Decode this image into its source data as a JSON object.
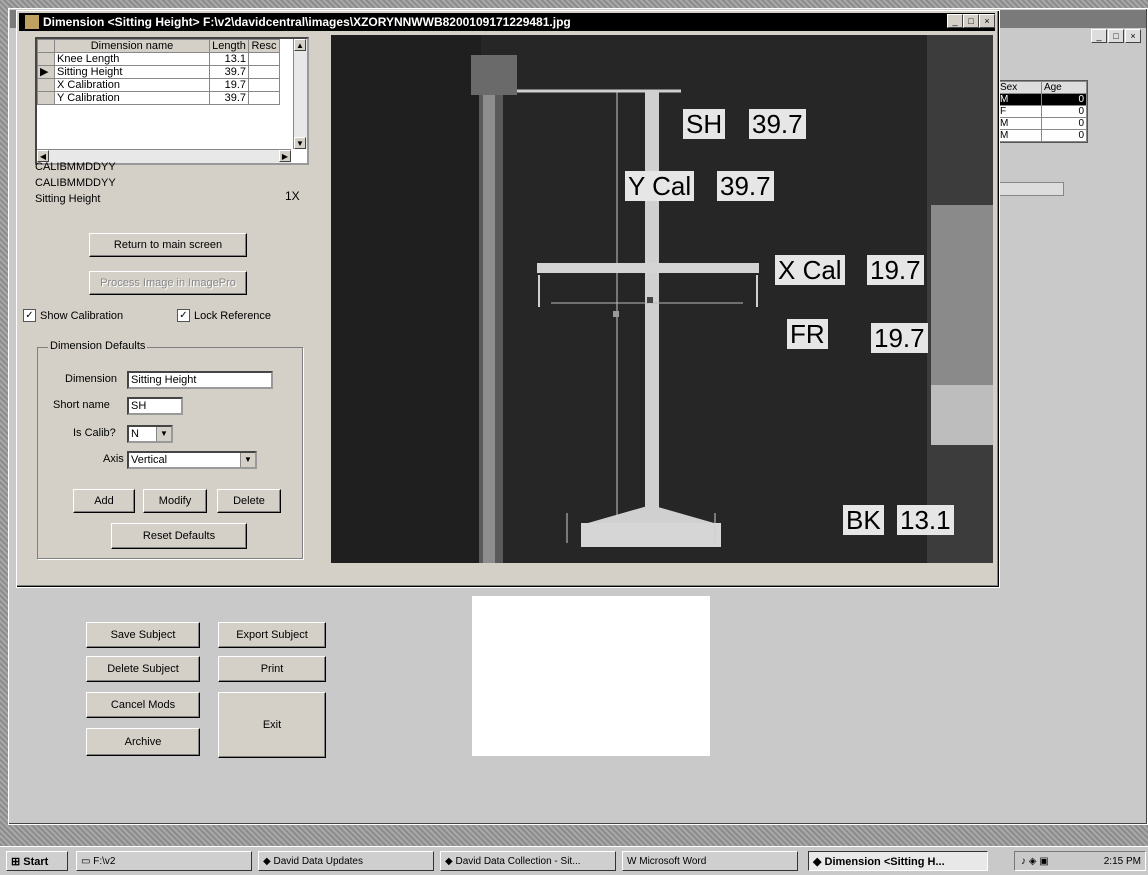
{
  "dialog": {
    "title": "Dimension <Sitting Height> F:\\v2\\davidcentral\\images\\XZORYNNWWB8200109171229481.jpg",
    "controls": [
      "_",
      "□",
      "×"
    ]
  },
  "dimension_list": {
    "headers": [
      "Dimension name",
      "Length",
      "Resc"
    ],
    "rows": [
      {
        "name": "Knee Length",
        "length": "13.1",
        "marker": ""
      },
      {
        "name": "Sitting Height",
        "length": "39.7",
        "marker": "▶"
      },
      {
        "name": "X Calibration",
        "length": "19.7",
        "marker": ""
      },
      {
        "name": "Y Calibration",
        "length": "39.7",
        "marker": ""
      }
    ]
  },
  "info": {
    "line1": "CALIBMMDDYY",
    "line2": "CALIBMMDDYY",
    "line3": "Sitting Height",
    "zoom": "1X"
  },
  "buttons": {
    "return_main": "Return to main screen",
    "process_image": "Process Image in ImagePro",
    "add": "Add",
    "modify": "Modify",
    "delete": "Delete",
    "reset_defaults": "Reset Defaults",
    "save_subject": "Save Subject",
    "export_subject": "Export Subject",
    "delete_subject": "Delete Subject",
    "print": "Print",
    "cancel_mods": "Cancel Mods",
    "exit": "Exit",
    "archive": "Archive"
  },
  "checkboxes": {
    "show_calibration": {
      "label": "Show Calibration",
      "checked": true
    },
    "lock_reference": {
      "label": "Lock Reference",
      "checked": true
    }
  },
  "defaults_group": {
    "title": "Dimension Defaults",
    "dimension_label": "Dimension",
    "dimension_value": "Sitting Height",
    "short_name_label": "Short name",
    "short_name_value": "SH",
    "is_calib_label": "Is Calib?",
    "is_calib_value": "N",
    "axis_label": "Axis",
    "axis_value": "Vertical"
  },
  "overlays": {
    "sh_label": "SH",
    "sh_value": "39.7",
    "ycal_label": "Y Cal",
    "ycal_value": "39.7",
    "xcal_label": "X Cal",
    "xcal_value": "19.7",
    "fr_label": "FR",
    "fr_value": "19.7",
    "bk_label": "BK",
    "bk_value": "13.1"
  },
  "subject_grid": {
    "headers": [
      "Sex",
      "Age"
    ],
    "rows": [
      {
        "sex": "M",
        "age": "0"
      },
      {
        "sex": "F",
        "age": "0"
      },
      {
        "sex": "M",
        "age": "0"
      },
      {
        "sex": "M",
        "age": "0"
      }
    ]
  },
  "taskbar": {
    "start": "Start",
    "items": [
      "F:\\v2",
      "David Data Updates",
      "David Data Collection - Sit...",
      "Microsoft Word",
      "Dimension <Sitting H..."
    ],
    "clock": "2:15 PM"
  },
  "colors": {
    "titlebar": "#000000",
    "dialog": "#d4d0c8",
    "photo_bg": "#202020"
  }
}
